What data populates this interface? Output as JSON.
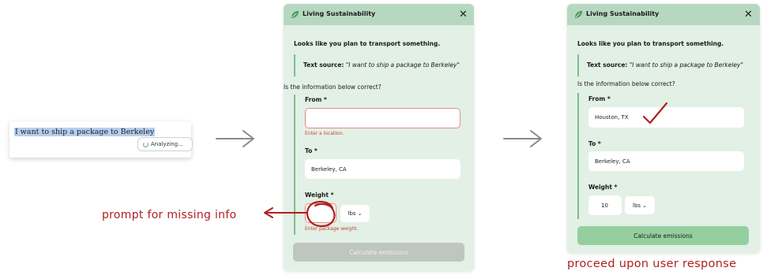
{
  "stage1": {
    "doc_text": "I want to ship a package to Berkeley",
    "status_label": "Analyzing..."
  },
  "panel": {
    "title": "Living Sustainability",
    "close_glyph": "✕",
    "intro": "Looks like you plan to transport something.",
    "source_label": "Text source:",
    "source_quote": "\"I want to ship a package to Berkeley\"",
    "question": "Is the information below correct?",
    "from_label": "From *",
    "to_label": "To *",
    "weight_label": "Weight *",
    "unit": "lbs",
    "button_label": "Calculate emissions"
  },
  "stage2": {
    "from_value": "",
    "from_error": "Enter a location.",
    "to_value": "Berkeley, CA",
    "weight_value": "",
    "weight_error": "Enter package weight."
  },
  "stage3": {
    "from_value": "Houston, TX",
    "to_value": "Berkeley, CA",
    "weight_value": "10"
  },
  "annotations": {
    "prompt_note": "prompt for missing info",
    "proceed_note": "proceed upon user response"
  },
  "colors": {
    "panel_bg": "#e2f0e5",
    "header_bg": "#b7d8c0",
    "accent": "#7dbe8d",
    "error": "#cf3f36",
    "annotation": "#b0201f"
  }
}
